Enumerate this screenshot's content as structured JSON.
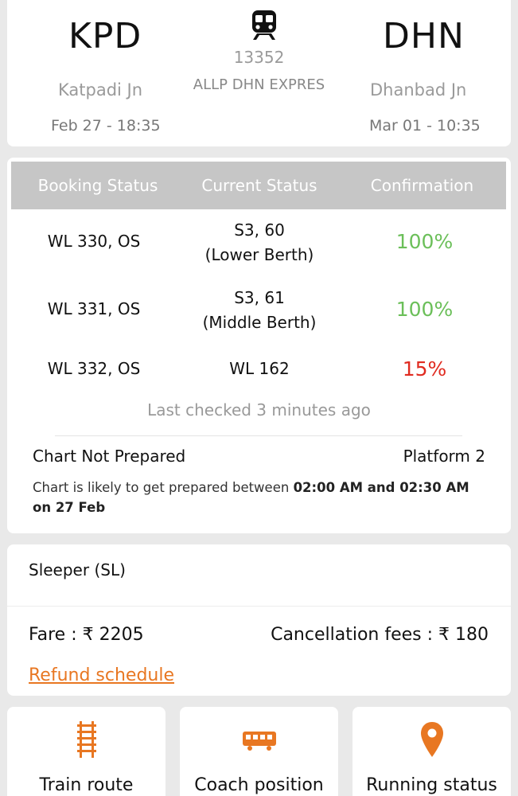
{
  "journey": {
    "from": {
      "code": "KPD",
      "name": "Katpadi Jn",
      "datetime": "Feb 27 - 18:35"
    },
    "to": {
      "code": "DHN",
      "name": "Dhanbad Jn",
      "datetime": "Mar 01 - 10:35"
    },
    "train_number": "13352",
    "train_name": "ALLP DHN EXPRES",
    "icon": "train-icon"
  },
  "status_table": {
    "headers": [
      "Booking Status",
      "Current Status",
      "Confirmation"
    ],
    "rows": [
      {
        "booking": "WL 330, OS",
        "current_line1": "S3, 60",
        "current_line2": "(Lower Berth)",
        "confirmation": "100%"
      },
      {
        "booking": "WL 331, OS",
        "current_line1": "S3, 61",
        "current_line2": "(Middle Berth)",
        "confirmation": "100%"
      },
      {
        "booking": "WL 332, OS",
        "current_line1": "WL 162",
        "current_line2": "",
        "confirmation": "15%"
      }
    ],
    "last_checked": "Last checked 3 minutes ago",
    "chart_status": "Chart Not Prepared",
    "platform": "Platform 2",
    "chart_note_prefix": "Chart is likely to get prepared between ",
    "chart_note_time": "02:00 AM and 02:30 AM",
    "chart_note_date": "on 27 Feb"
  },
  "fare": {
    "class": "Sleeper (SL)",
    "fare_text": "Fare : ₹ 2205",
    "cancellation_text": "Cancellation fees : ₹ 180",
    "refund_link": "Refund schedule"
  },
  "actions": [
    {
      "label": "Train route",
      "icon": "track-icon"
    },
    {
      "label": "Coach position",
      "icon": "coach-icon"
    },
    {
      "label": "Running status",
      "icon": "location-pin-icon"
    }
  ],
  "colors": {
    "accent": "#e87722",
    "confirm_high": "#6bbf59",
    "confirm_low": "#e02b20",
    "header_bg": "#c6c6c6"
  }
}
